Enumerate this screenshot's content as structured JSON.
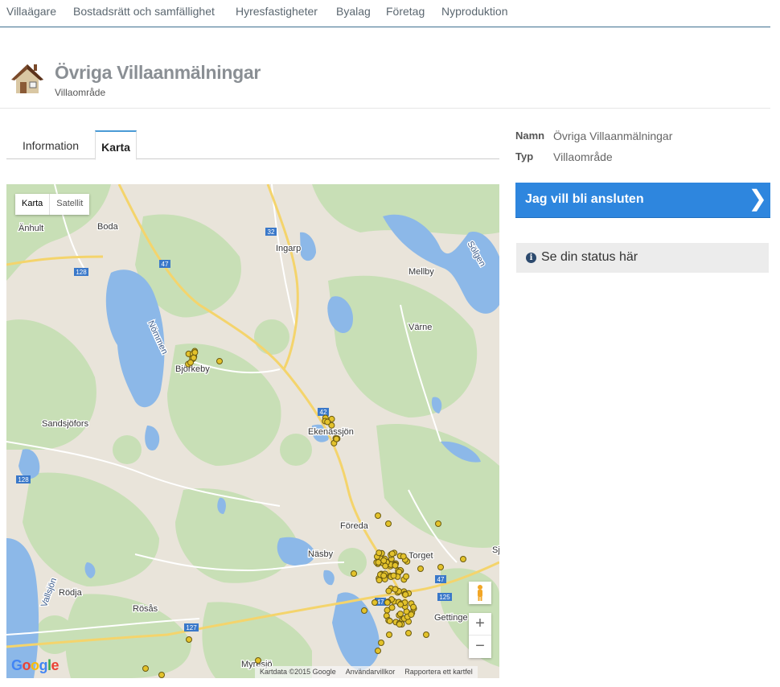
{
  "nav": {
    "items": [
      "Villaägare",
      "Bostadsrätt och samfällighet",
      "Hyresfastigheter",
      "Byalag",
      "Företag",
      "Nyproduktion"
    ]
  },
  "header": {
    "icon": "house-icon",
    "title": "Övriga Villaanmälningar",
    "subtitle": "Villaområde"
  },
  "tabs": {
    "items": [
      {
        "label": "Information",
        "active": false
      },
      {
        "label": "Karta",
        "active": true
      }
    ]
  },
  "map": {
    "type_buttons": [
      "Karta",
      "Satellit"
    ],
    "selected_type": "Karta",
    "logo": "Google",
    "footer": [
      "Kartdata ©2015 Google",
      "Användarvillkor",
      "Rapportera ett kartfel"
    ],
    "zoom_in": "+",
    "zoom_out": "−",
    "place_labels": [
      "Änhult",
      "Boda",
      "Ingarp",
      "Mellby",
      "Sölgen",
      "Nömmen",
      "Björkeby",
      "Värne",
      "Sandsjöfors",
      "Ekenässjön",
      "Föreda",
      "Näsby",
      "Torget",
      "Rödja",
      "Rösås",
      "Gettinge",
      "Vallsjön",
      "Myresjö",
      "Sj"
    ],
    "road_labels": [
      "32",
      "47",
      "128",
      "42",
      "128",
      "47",
      "125",
      "127",
      "47"
    ],
    "colors": {
      "land": "#e9e4da",
      "forest": "#c8dfb6",
      "water": "#8cb8e8",
      "road_major": "#f4d46c",
      "marker": "#e3c22b"
    }
  },
  "details": {
    "name_label": "Namn",
    "name_value": "Övriga Villaanmälningar",
    "type_label": "Typ",
    "type_value": "Villaområde"
  },
  "cta": {
    "label": "Jag vill bli ansluten",
    "chevron": "❯",
    "color": "#2e86de"
  },
  "status": {
    "icon": "info-icon",
    "label": "Se din status här"
  }
}
